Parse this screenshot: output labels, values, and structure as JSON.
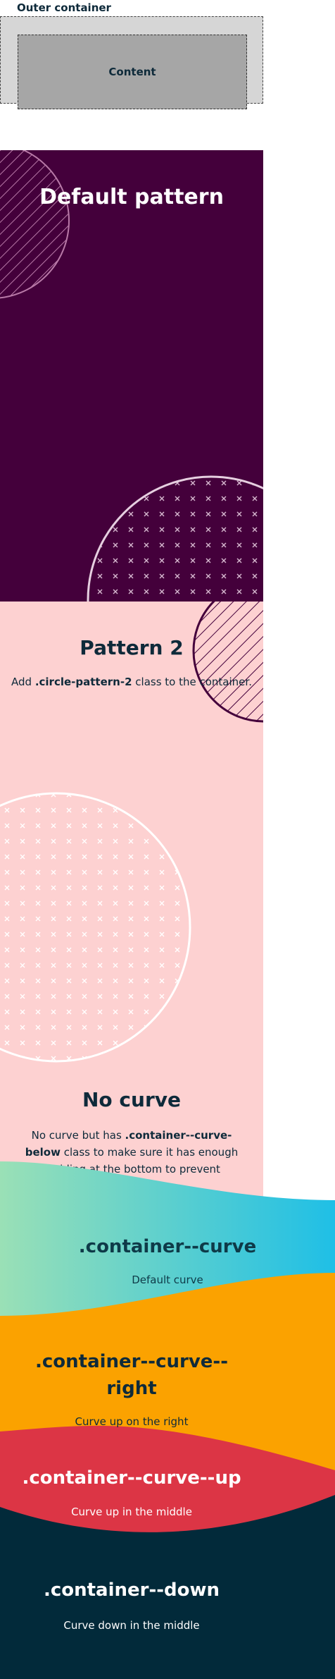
{
  "outer": {
    "label": "Outer container",
    "content": "Content"
  },
  "default_pattern": {
    "title": "Default pattern"
  },
  "pattern2": {
    "title": "Pattern 2",
    "text_before": "Add ",
    "class_name": ".circle-pattern-2",
    "text_after": " class to the container."
  },
  "no_curve": {
    "title": "No curve",
    "text_before": "No curve but has ",
    "class_name": ".container--curve-below",
    "text_after": " class to make sure it has enough padding at the bottom to prevent overlap."
  },
  "curve": {
    "title": ".container--curve",
    "subtitle": "Default curve"
  },
  "curve_right": {
    "title": ".container--curve--right",
    "subtitle": "Curve up on the right"
  },
  "curve_up": {
    "title": ".container--curve--up",
    "subtitle": "Curve up in the middle"
  },
  "curve_down": {
    "title": ".container--down",
    "subtitle": "Curve down in the middle"
  },
  "colors": {
    "purple": "#44003b",
    "pink": "#fdd1d1",
    "teal_start": "#9ae0b6",
    "teal_end": "#1fbfe6",
    "orange": "#fba200",
    "red": "#dc3545",
    "navy": "#022a3a"
  }
}
